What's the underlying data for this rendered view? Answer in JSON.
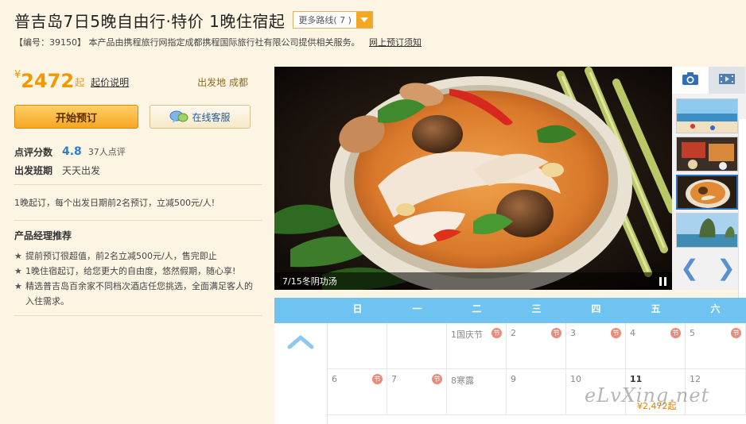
{
  "header": {
    "title": "普吉岛7日5晚自由行·特价 1晚住宿起",
    "more_routes_label": "更多路线",
    "more_routes_count": "( 7 )"
  },
  "info": {
    "text": "【编号：39150】 本产品由携程旅行网指定成都携程国际旅行社有限公司提供相关服务。",
    "link": "网上预订须知"
  },
  "price": {
    "currency": "¥",
    "amount": "2472",
    "suffix": "起",
    "explain": "起价说明",
    "depart": "出发地 成都"
  },
  "buttons": {
    "book": "开始预订",
    "chat": "在线客服"
  },
  "rating": {
    "label": "点评分数",
    "score": "4.8",
    "count": "37人点评"
  },
  "schedule": {
    "label": "出发班期",
    "value": "天天出发"
  },
  "promo": "1晚起订，每个出发日期前2名预订，立减500元/人!",
  "recommend": {
    "title": "产品经理推荐",
    "items": [
      "提前预订很超值，前2名立减500元/人，售完即止",
      "1晚住宿起订，给您更大的自由度，悠然假期，随心享!",
      "精选普吉岛百余家不同档次酒店任您挑选，全面满足客人的入住需求。"
    ]
  },
  "photo": {
    "caption": "7/15冬阴功汤"
  },
  "calendar": {
    "weekdays": [
      "日",
      "一",
      "二",
      "三",
      "四",
      "五",
      "六"
    ],
    "row1": [
      "",
      "",
      "1国庆节",
      "2",
      "3",
      "4",
      "5"
    ],
    "row2": [
      "6",
      "7",
      "8寒露",
      "9",
      "10",
      "11",
      "12"
    ],
    "row2_price": "¥2,472起",
    "holiday_mark": "节"
  },
  "watermark": "eLvXing.net",
  "colors": {
    "accent_orange": "#f39800",
    "calendar_blue": "#6ec3f0",
    "link_blue": "#2a7fd4",
    "panel_bg": "#fdf5e4"
  }
}
